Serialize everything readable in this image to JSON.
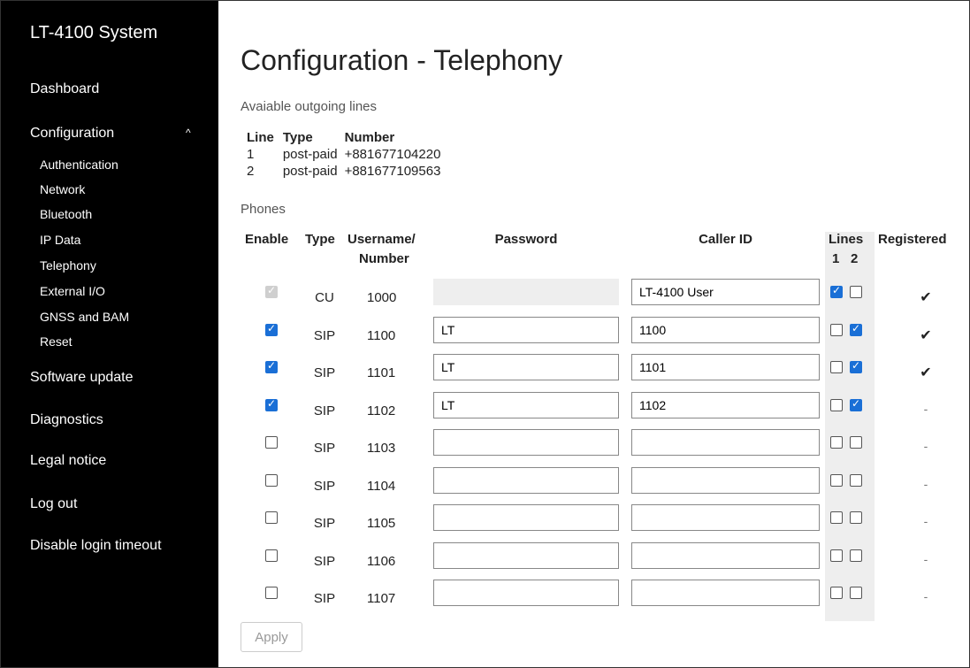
{
  "app": {
    "title": "LT-4100 System"
  },
  "nav": {
    "dashboard": "Dashboard",
    "configuration": "Configuration",
    "config_items": [
      "Authentication",
      "Network",
      "Bluetooth",
      "IP Data",
      "Telephony",
      "External I/O",
      "GNSS and BAM",
      "Reset"
    ],
    "software_update": "Software update",
    "diagnostics": "Diagnostics",
    "legal": "Legal notice",
    "logout": "Log out",
    "disable_timeout": "Disable login timeout"
  },
  "page": {
    "title": "Configuration - Telephony",
    "outgoing_label": "Avaiable outgoing lines",
    "phones_label": "Phones"
  },
  "lines_table": {
    "headers": [
      "Line",
      "Type",
      "Number"
    ],
    "rows": [
      [
        "1",
        "post-paid",
        "+881677104220"
      ],
      [
        "2",
        "post-paid",
        "+881677109563"
      ]
    ]
  },
  "phones": {
    "headers": {
      "enable": "Enable",
      "type": "Type",
      "username_1": "Username/",
      "username_2": "Number",
      "password": "Password",
      "caller_id": "Caller ID",
      "lines": "Lines",
      "line1": "1",
      "line2": "2",
      "registered": "Registered"
    },
    "rows": [
      {
        "enable": "checked-disabled",
        "type": "CU",
        "number": "1000",
        "password": "",
        "password_disabled": true,
        "caller_id": "LT-4100 User",
        "line1": true,
        "line2": false,
        "registered": "✔"
      },
      {
        "enable": "checked",
        "type": "SIP",
        "number": "1100",
        "password": "LT",
        "password_disabled": false,
        "caller_id": "1100",
        "line1": false,
        "line2": true,
        "registered": "✔"
      },
      {
        "enable": "checked",
        "type": "SIP",
        "number": "1101",
        "password": "LT",
        "password_disabled": false,
        "caller_id": "1101",
        "line1": false,
        "line2": true,
        "registered": "✔"
      },
      {
        "enable": "checked",
        "type": "SIP",
        "number": "1102",
        "password": "LT",
        "password_disabled": false,
        "caller_id": "1102",
        "line1": false,
        "line2": true,
        "registered": "-"
      },
      {
        "enable": "unchecked",
        "type": "SIP",
        "number": "1103",
        "password": "",
        "password_disabled": false,
        "caller_id": "",
        "line1": false,
        "line2": false,
        "registered": "-"
      },
      {
        "enable": "unchecked",
        "type": "SIP",
        "number": "1104",
        "password": "",
        "password_disabled": false,
        "caller_id": "",
        "line1": false,
        "line2": false,
        "registered": "-"
      },
      {
        "enable": "unchecked",
        "type": "SIP",
        "number": "1105",
        "password": "",
        "password_disabled": false,
        "caller_id": "",
        "line1": false,
        "line2": false,
        "registered": "-"
      },
      {
        "enable": "unchecked",
        "type": "SIP",
        "number": "1106",
        "password": "",
        "password_disabled": false,
        "caller_id": "",
        "line1": false,
        "line2": false,
        "registered": "-"
      },
      {
        "enable": "unchecked",
        "type": "SIP",
        "number": "1107",
        "password": "",
        "password_disabled": false,
        "caller_id": "",
        "line1": false,
        "line2": false,
        "registered": "-"
      }
    ]
  },
  "apply_label": "Apply",
  "colors": {
    "sidebar_bg": "#000000",
    "checkbox_accent": "#1a6fd6",
    "lines_column_bg": "#eeeeee"
  }
}
